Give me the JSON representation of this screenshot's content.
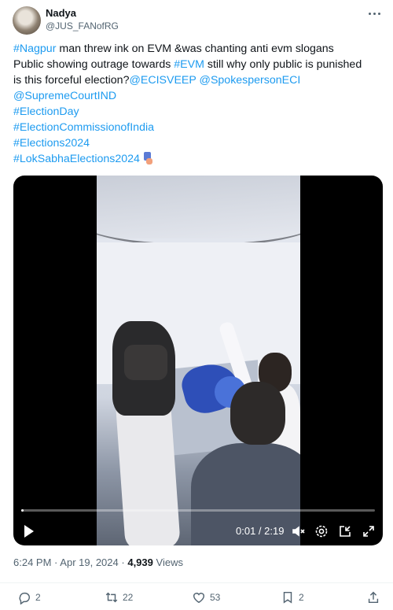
{
  "author": {
    "name": "Nadya",
    "handle": "@JUS_FANofRG"
  },
  "tweet": {
    "lines": [
      [
        {
          "text": "#Nagpur",
          "link": true
        },
        {
          "text": " man threw ink on EVM &was chanting anti evm slogans",
          "link": false
        }
      ],
      [
        {
          "text": "Public showing outrage towards ",
          "link": false
        },
        {
          "text": "#EVM",
          "link": true
        },
        {
          "text": " still why only public is punished",
          "link": false
        }
      ],
      [
        {
          "text": "is this forceful election?",
          "link": false
        },
        {
          "text": "@ECISVEEP",
          "link": true
        },
        {
          "text": " ",
          "link": false
        },
        {
          "text": "@SpokespersonECI",
          "link": true
        }
      ],
      [
        {
          "text": "@SupremeCourtIND",
          "link": true
        }
      ],
      [
        {
          "text": "#ElectionDay",
          "link": true
        }
      ],
      [
        {
          "text": "#ElectionCommissionofIndia",
          "link": true
        }
      ],
      [
        {
          "text": "#Elections2024",
          "link": true
        }
      ],
      [
        {
          "text": "#LokSabhaElections2024",
          "link": true
        }
      ]
    ],
    "trailing_emoji": "ballot-box-with-hand-emoji"
  },
  "video": {
    "time_display": "0:01 / 2:19",
    "progress_fraction": 0.007
  },
  "meta": {
    "time": "6:24 PM",
    "separator": "·",
    "date": "Apr 19, 2024",
    "views_count": "4,939",
    "views_label": "Views"
  },
  "actions": {
    "replies": "2",
    "reposts": "22",
    "likes": "53",
    "bookmarks": "2"
  },
  "colors": {
    "link": "#1d9bf0",
    "text": "#0f1419",
    "secondary": "#536471"
  },
  "icons": [
    "more-icon",
    "play-icon",
    "volume-muted-icon",
    "settings-icon",
    "pip-icon",
    "fullscreen-icon",
    "reply-icon",
    "repost-icon",
    "like-icon",
    "bookmark-icon",
    "share-icon"
  ]
}
